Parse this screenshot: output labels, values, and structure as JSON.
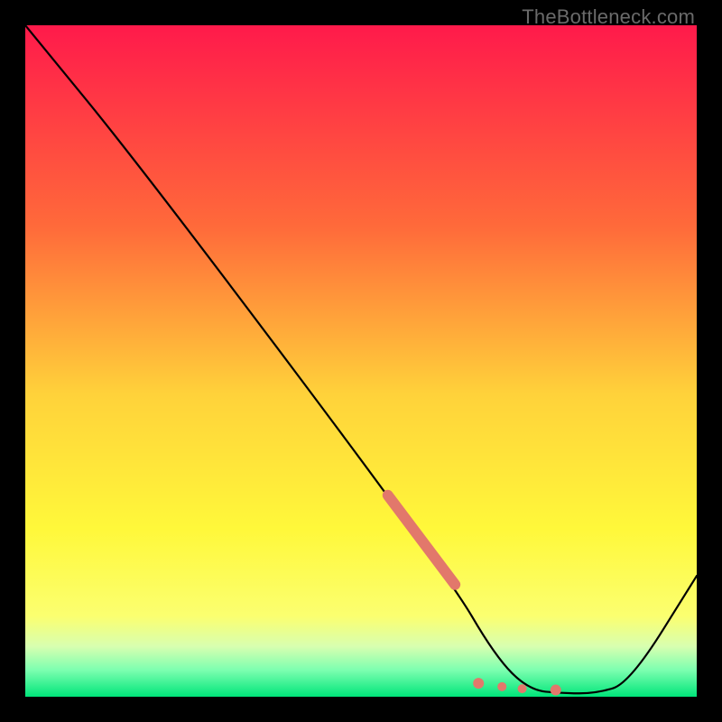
{
  "watermark": "TheBottleneck.com",
  "chart_data": {
    "type": "line",
    "title": "",
    "xlabel": "",
    "ylabel": "",
    "xlim": [
      0,
      100
    ],
    "ylim": [
      0,
      100
    ],
    "grid": false,
    "legend": false,
    "series": [
      {
        "name": "curve",
        "x": [
          0,
          18,
          63,
          70,
          75,
          80,
          85,
          90,
          100
        ],
        "values": [
          100,
          78,
          18,
          6,
          1,
          0.5,
          0.5,
          2,
          18
        ]
      }
    ],
    "highlight_segment": {
      "name": "thick-salmon-segment",
      "x": [
        54,
        64
      ],
      "values": [
        30,
        16.7
      ]
    },
    "highlight_dots": {
      "name": "salmon-dots",
      "points": [
        {
          "x": 67.5,
          "y": 2.0
        },
        {
          "x": 71,
          "y": 1.5
        },
        {
          "x": 74,
          "y": 1.2
        },
        {
          "x": 79,
          "y": 1.0
        }
      ]
    },
    "gradient_stops": [
      {
        "offset": 0.0,
        "color": "#ff1a4b"
      },
      {
        "offset": 0.3,
        "color": "#ff6a3a"
      },
      {
        "offset": 0.55,
        "color": "#ffd23a"
      },
      {
        "offset": 0.75,
        "color": "#fff83a"
      },
      {
        "offset": 0.88,
        "color": "#fbff70"
      },
      {
        "offset": 0.925,
        "color": "#d8ffb0"
      },
      {
        "offset": 0.96,
        "color": "#7dffb0"
      },
      {
        "offset": 1.0,
        "color": "#00e57a"
      }
    ]
  }
}
